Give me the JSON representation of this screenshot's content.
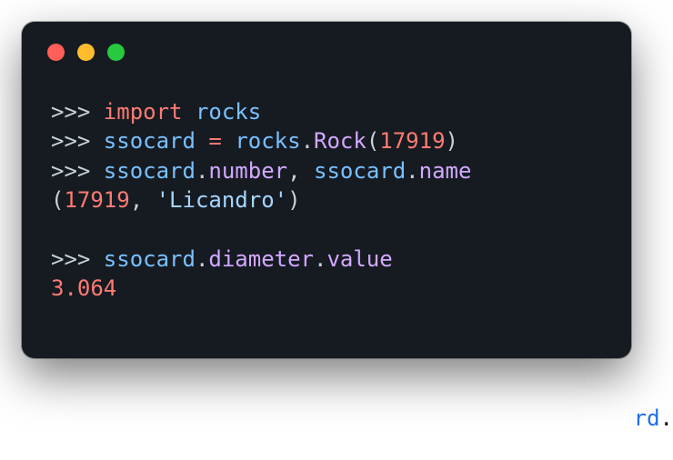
{
  "code": {
    "prompt": ">>> ",
    "line1": {
      "kw": "import",
      "module": "rocks"
    },
    "line2": {
      "var": "ssocard",
      "eq": " = ",
      "obj": "rocks",
      "dot": ".",
      "ctor": "Rock",
      "open": "(",
      "arg": "17919",
      "close": ")"
    },
    "line3": {
      "var": "ssocard",
      "dot1": ".",
      "attr1": "number",
      "comma": ", ",
      "var2": "ssocard",
      "dot2": ".",
      "attr2": "name"
    },
    "line4": {
      "open": "(",
      "num": "17919",
      "comma": ", ",
      "str": "'Licandro'",
      "close": ")"
    },
    "line5": {
      "var": "ssocard",
      "dot1": ".",
      "attr1": "diameter",
      "dot2": ".",
      "attr2": "value"
    },
    "line6": {
      "num": "3.064"
    }
  },
  "bg": {
    "frag": "rd",
    "dot": "."
  }
}
